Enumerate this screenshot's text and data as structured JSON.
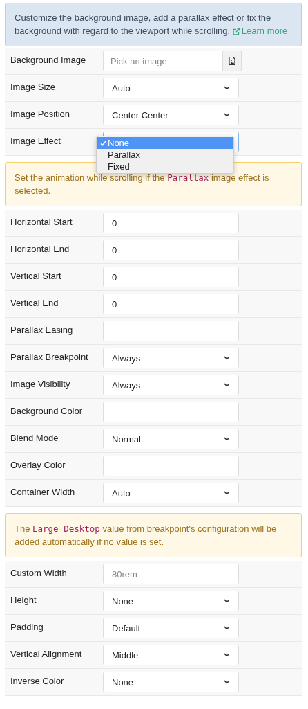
{
  "info_notice": {
    "text": "Customize the background image, add a parallax effect or fix the background with regard to the viewport while scrolling.",
    "link": "Learn more"
  },
  "sections": [
    {
      "kind": "fields",
      "fields": [
        {
          "kind": "file",
          "label": "Background Image",
          "placeholder": "Pick an image"
        },
        {
          "kind": "select",
          "label": "Image Size",
          "value": "Auto"
        },
        {
          "kind": "select",
          "label": "Image Position",
          "value": "Center Center"
        },
        {
          "kind": "select",
          "label": "Image Effect",
          "open": true,
          "options": [
            {
              "label": "None",
              "selected": true
            },
            {
              "label": "Parallax",
              "selected": false
            },
            {
              "label": "Fixed",
              "selected": false
            }
          ]
        }
      ]
    },
    {
      "kind": "warning",
      "parts": [
        {
          "kind": "text",
          "text": "Set the animation while scrolling if the "
        },
        {
          "kind": "code",
          "text": "Parallax"
        },
        {
          "kind": "text",
          "text": " image effect is selected."
        }
      ]
    },
    {
      "kind": "fields",
      "fields": [
        {
          "kind": "text",
          "label": "Horizontal Start",
          "value": "0"
        },
        {
          "kind": "text",
          "label": "Horizontal End",
          "value": "0"
        },
        {
          "kind": "text",
          "label": "Vertical Start",
          "value": "0"
        },
        {
          "kind": "text",
          "label": "Vertical End",
          "value": "0"
        },
        {
          "kind": "text",
          "label": "Parallax Easing"
        },
        {
          "kind": "select",
          "label": "Parallax Breakpoint",
          "value": "Always"
        },
        {
          "kind": "select",
          "label": "Image Visibility",
          "value": "Always"
        },
        {
          "kind": "text",
          "label": "Background Color"
        },
        {
          "kind": "select",
          "label": "Blend Mode",
          "value": "Normal"
        },
        {
          "kind": "text",
          "label": "Overlay Color"
        },
        {
          "kind": "select",
          "label": "Container Width",
          "value": "Auto"
        }
      ]
    },
    {
      "kind": "warning",
      "parts": [
        {
          "kind": "text",
          "text": "The "
        },
        {
          "kind": "code",
          "text": "Large Desktop"
        },
        {
          "kind": "text",
          "text": " value from breakpoint's configuration will be added automatically if no value is set."
        }
      ]
    },
    {
      "kind": "fields",
      "fields": [
        {
          "kind": "text",
          "label": "Custom Width",
          "placeholder": "80rem"
        },
        {
          "kind": "select",
          "label": "Height",
          "value": "None"
        },
        {
          "kind": "select",
          "label": "Padding",
          "value": "Default"
        },
        {
          "kind": "select",
          "label": "Vertical Alignment",
          "value": "Middle"
        },
        {
          "kind": "select",
          "label": "Inverse Color",
          "value": "None"
        }
      ]
    }
  ]
}
